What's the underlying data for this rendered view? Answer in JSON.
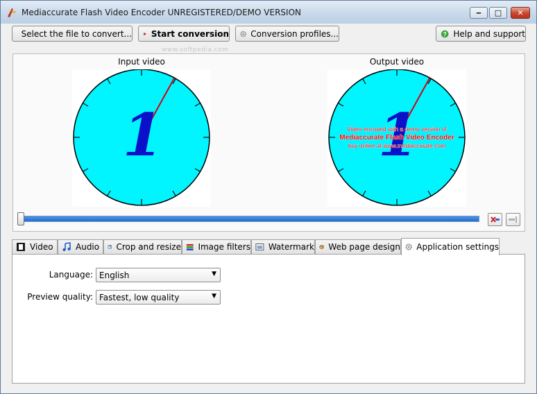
{
  "window": {
    "title": "Mediaccurate Flash Video Encoder UNREGISTERED/DEMO VERSION",
    "controls": {
      "minimize": "‒",
      "maximize": "□",
      "close": "✕"
    }
  },
  "toolbar": {
    "select_file_label": "Select the file to convert...",
    "start_conversion_label": "Start conversion",
    "conversion_profiles_label": "Conversion profiles...",
    "help_label": "Help and support"
  },
  "watermark_text": "www.softpedia.com",
  "preview": {
    "input_label": "Input video",
    "output_label": "Output video",
    "clock_digit": "1",
    "demo_overlay": {
      "line1": "Video encoded with a demo version of",
      "line2": "Mediaccurate Flash Video Encoder",
      "line3": "buy online at www.mediaccurate.com"
    },
    "position_fraction": 0,
    "colors": {
      "dial": "#00f5ff",
      "hand": "#d0000f",
      "digit": "#0b10c9",
      "overlay": "#ff0000"
    }
  },
  "tabs": [
    {
      "label": "Video",
      "icon": "film-icon"
    },
    {
      "label": "Audio",
      "icon": "music-note-icon"
    },
    {
      "label": "Crop and resize",
      "icon": "crop-icon"
    },
    {
      "label": "Image filters",
      "icon": "filters-icon"
    },
    {
      "label": "Watermark",
      "icon": "watermark-icon"
    },
    {
      "label": "Web page design",
      "icon": "palette-icon"
    },
    {
      "label": "Application settings",
      "icon": "gear-icon",
      "active": true
    }
  ],
  "settings": {
    "language_label": "Language:",
    "language_value": "English",
    "preview_quality_label": "Preview quality:",
    "preview_quality_value": "Fastest, low quality"
  }
}
